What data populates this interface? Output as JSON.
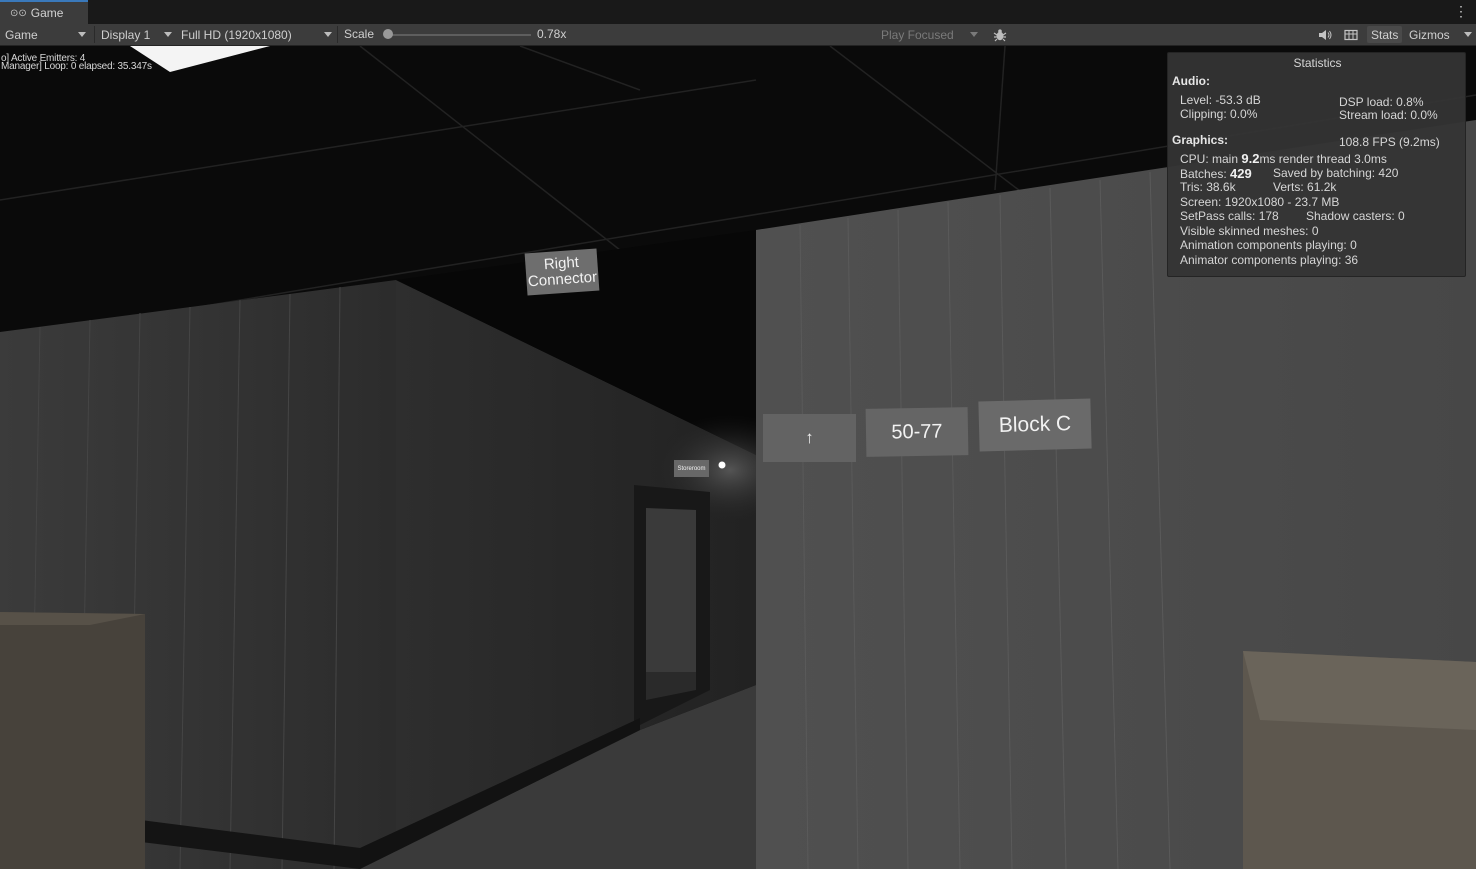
{
  "window": {
    "tab_title": "Game",
    "tab_icon": "gamepad-icon",
    "menu_icon": "kebab-menu-icon"
  },
  "toolbar": {
    "view_mode": "Game",
    "display": "Display 1",
    "resolution": "Full HD (1920x1080)",
    "scale_label": "Scale",
    "scale_value": "0.78x",
    "scale_fraction": 0.0,
    "play_mode": "Play Focused",
    "bug_icon": "bug-icon",
    "audio_icon": "speaker-icon",
    "aspect_icon": "grid-icon",
    "stats_label": "Stats",
    "gizmos_label": "Gizmos"
  },
  "debug_text": {
    "line1": "o] Active Emitters: 4",
    "line2": "Manager] Loop: 0 elapsed: 35.347s"
  },
  "scene_signs": {
    "corridor": "Right Connector",
    "arrow": "↑",
    "range": "50-77",
    "block": "Block C",
    "door": "Storeroom"
  },
  "statistics": {
    "title": "Statistics",
    "audio_heading": "Audio:",
    "level": "Level: -53.3 dB",
    "clipping": "Clipping: 0.0%",
    "dsp_load": "DSP load: 0.8%",
    "stream_load": "Stream load: 0.0%",
    "graphics_heading": "Graphics:",
    "fps": "108.8 FPS (9.2ms)",
    "cpu_prefix": "CPU: main ",
    "cpu_main": "9.2",
    "cpu_suffix": "ms  render thread 3.0ms",
    "batches_prefix": "Batches: ",
    "batches": "429",
    "saved_batching": "Saved by batching: 420",
    "tris": "Tris: 38.6k",
    "verts": "Verts: 61.2k",
    "screen": "Screen: 1920x1080 - 23.7 MB",
    "setpass": "SetPass calls: 178",
    "shadow_casters": "Shadow casters: 0",
    "skinned_meshes": "Visible skinned meshes: 0",
    "animation_components": "Animation components playing: 0",
    "animator_components": "Animator components playing: 36"
  },
  "colors": {
    "editor_dark": "#191919",
    "toolbar": "#3c3c3c",
    "tab_accent": "#3a79bb",
    "panel": "#343434"
  }
}
